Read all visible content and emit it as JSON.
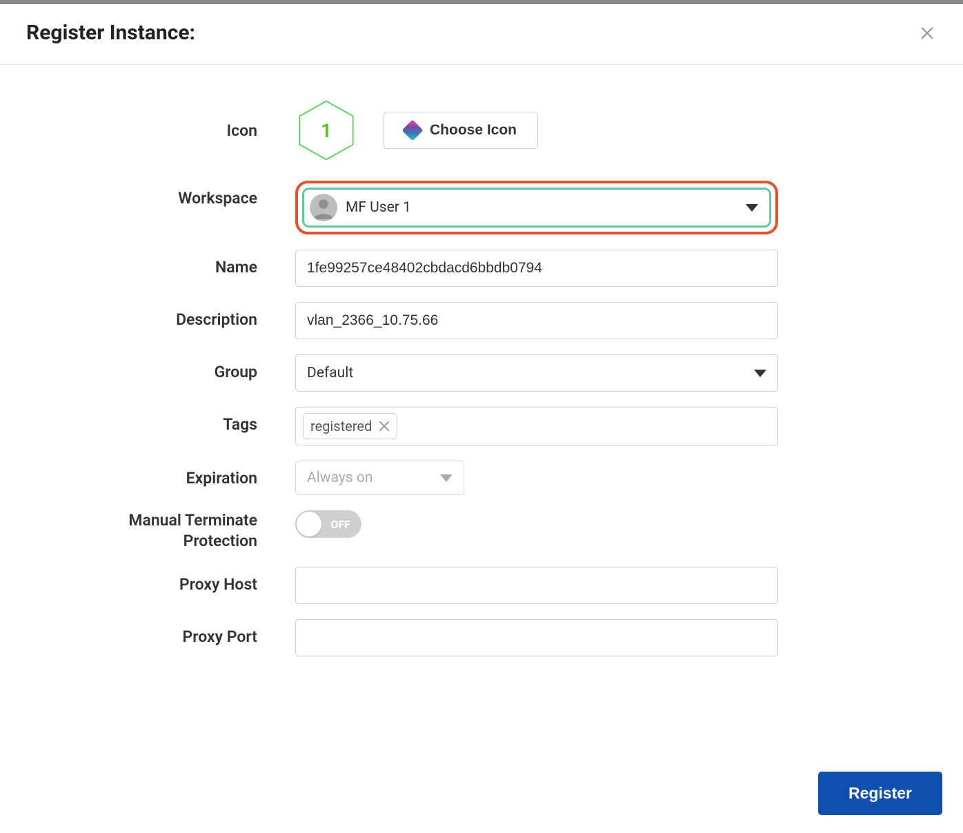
{
  "dialog": {
    "title": "Register Instance:"
  },
  "labels": {
    "icon": "Icon",
    "workspace": "Workspace",
    "name": "Name",
    "description": "Description",
    "group": "Group",
    "tags": "Tags",
    "expiration": "Expiration",
    "manual_terminate_protection_line1": "Manual Terminate",
    "manual_terminate_protection_line2": "Protection",
    "proxy_host": "Proxy Host",
    "proxy_port": "Proxy Port"
  },
  "icon": {
    "badge": "1",
    "choose_button": "Choose Icon"
  },
  "workspace": {
    "value": "MF User 1"
  },
  "name": {
    "value": "1fe99257ce48402cbdacd6bbdb0794"
  },
  "description": {
    "value": "vlan_2366_10.75.66"
  },
  "group": {
    "value": "Default"
  },
  "tags": {
    "items": [
      {
        "label": "registered"
      }
    ]
  },
  "expiration": {
    "value": "Always on"
  },
  "manual_terminate_protection": {
    "state": "OFF"
  },
  "proxy_host": {
    "value": ""
  },
  "proxy_port": {
    "value": ""
  },
  "footer": {
    "register_button": "Register"
  }
}
